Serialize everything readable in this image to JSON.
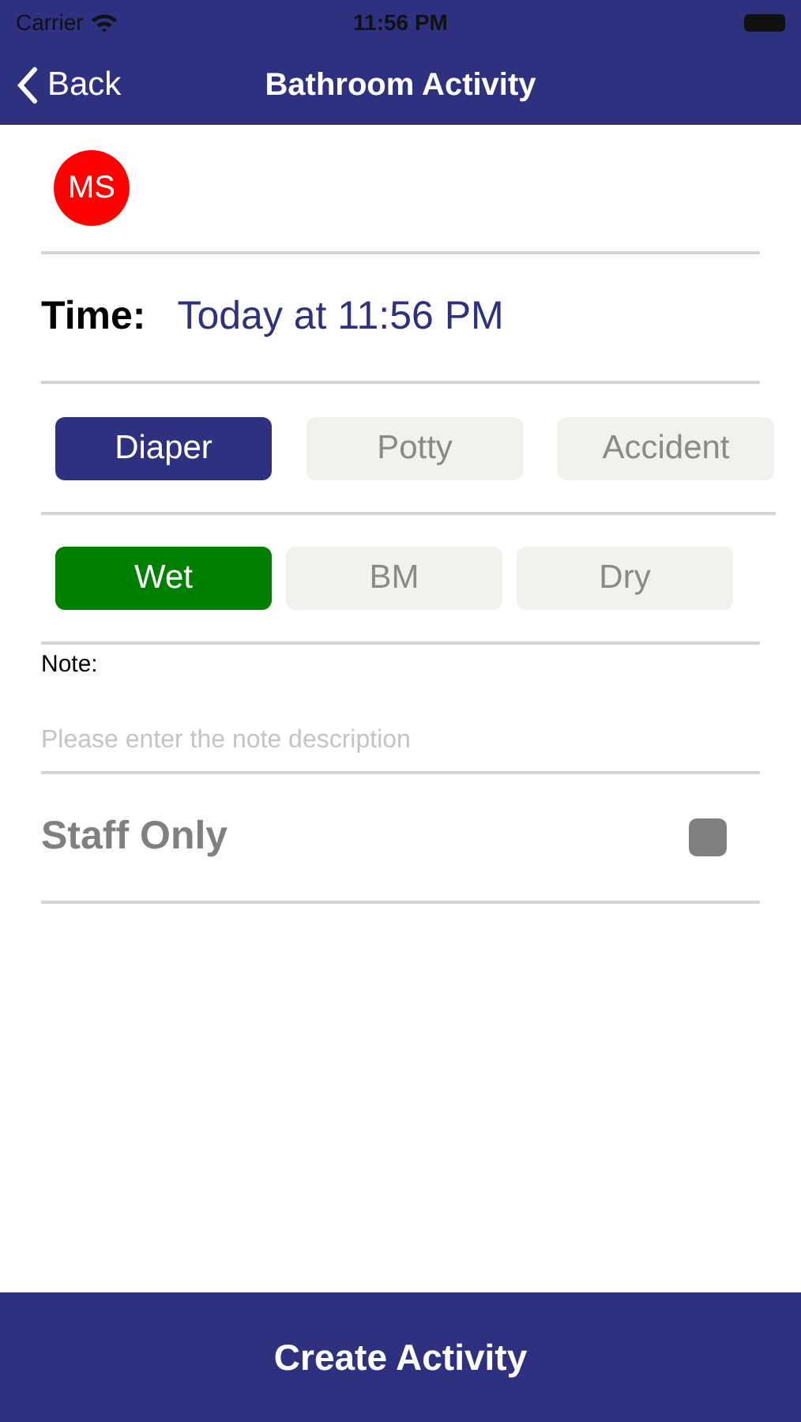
{
  "status_bar": {
    "carrier": "Carrier",
    "time": "11:56 PM"
  },
  "nav": {
    "back": "Back",
    "title": "Bathroom Activity"
  },
  "child": {
    "initials": "MS",
    "color": "#ff0000"
  },
  "time": {
    "label": "Time:",
    "value": "Today at 11:56 PM"
  },
  "types": [
    {
      "label": "Diaper",
      "selected": true
    },
    {
      "label": "Potty",
      "selected": false
    },
    {
      "label": "Accident",
      "selected": false
    }
  ],
  "conditions": [
    {
      "label": "Wet",
      "selected": true
    },
    {
      "label": "BM",
      "selected": false
    },
    {
      "label": "Dry",
      "selected": false
    }
  ],
  "note": {
    "label": "Note:",
    "placeholder": "Please enter the note description"
  },
  "staff_only": {
    "label": "Staff Only",
    "checked": false
  },
  "submit": "Create Activity"
}
